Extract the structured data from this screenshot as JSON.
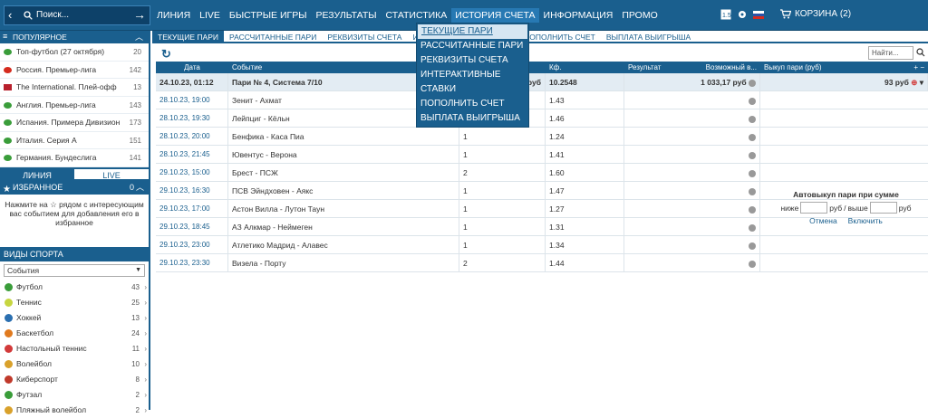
{
  "search": {
    "placeholder": "Поиск..."
  },
  "nav": [
    "ЛИНИЯ",
    "LIVE",
    "БЫСТРЫЕ ИГРЫ",
    "РЕЗУЛЬТАТЫ",
    "СТАТИСТИКА",
    "ИСТОРИЯ СЧЕТА",
    "ИНФОРМАЦИЯ",
    "ПРОМО"
  ],
  "cart": {
    "label": "КОРЗИНА (2)"
  },
  "popular": {
    "title": "ПОПУЛЯРНОЕ",
    "items": [
      {
        "label": "Топ-футбол (27 октября)",
        "count": "20"
      },
      {
        "label": "Россия. Премьер-лига",
        "count": "142"
      },
      {
        "label": "The International. Плей-офф",
        "count": "13"
      },
      {
        "label": "Англия. Премьер-лига",
        "count": "143"
      },
      {
        "label": "Испания. Примера Дивизион",
        "count": "173"
      },
      {
        "label": "Италия. Серия А",
        "count": "151"
      },
      {
        "label": "Германия. Бундеслига",
        "count": "141"
      }
    ]
  },
  "sidetabs": {
    "line": "ЛИНИЯ",
    "live": "LIVE"
  },
  "favorites": {
    "title": "ИЗБРАННОЕ",
    "count": "0",
    "text": "Нажмите на ☆ рядом с интересующим вас событием для добавления его в избранное"
  },
  "sports": {
    "title": "ВИДЫ СПОРТА",
    "select": "События",
    "items": [
      {
        "label": "Футбол",
        "count": "43",
        "color": "#3a9d3a"
      },
      {
        "label": "Теннис",
        "count": "25",
        "color": "#c7d640"
      },
      {
        "label": "Хоккей",
        "count": "13",
        "color": "#2b6fb0"
      },
      {
        "label": "Баскетбол",
        "count": "24",
        "color": "#e07a1e"
      },
      {
        "label": "Настольный теннис",
        "count": "11",
        "color": "#d23a3a"
      },
      {
        "label": "Волейбол",
        "count": "10",
        "color": "#d9a12b"
      },
      {
        "label": "Киберспорт",
        "count": "8",
        "color": "#c0392b"
      },
      {
        "label": "Футзал",
        "count": "2",
        "color": "#3a9d3a"
      },
      {
        "label": "Пляжный волейбол",
        "count": "2",
        "color": "#d9a12b"
      }
    ]
  },
  "subtabs": [
    "ТЕКУЩИЕ ПАРИ",
    "РАССЧИТАННЫЕ ПАРИ",
    "РЕКВИЗИТЫ СЧЕТА",
    "ИНТЕРАКТИВНЫЕ СТАВКИ",
    "ПОПОЛНИТЬ СЧЕТ",
    "ВЫПЛАТА ВЫИГРЫША"
  ],
  "table_search": "Найти...",
  "headers": {
    "date": "Дата",
    "event": "Событие",
    "outcome": "Исход",
    "kf": "Кф.",
    "result": "Результат",
    "possible": "Возможный в...",
    "buyout": "Выкуп пари (руб)"
  },
  "summary": {
    "date": "24.10.23, 01:12",
    "event": "Пари № 4, Система 7/10",
    "stake": "100 руб",
    "kf": "10.2548",
    "possible": "1 033,17 руб",
    "buyout": "93 руб"
  },
  "rows": [
    {
      "date": "28.10.23, 19:00",
      "event": "Зенит - Ахмат",
      "out": "1",
      "kf": "1.43"
    },
    {
      "date": "28.10.23, 19:30",
      "event": "Лейпциг - Кёльн",
      "out": "1",
      "kf": "1.46"
    },
    {
      "date": "28.10.23, 20:00",
      "event": "Бенфика - Каса Пиа",
      "out": "1",
      "kf": "1.24"
    },
    {
      "date": "28.10.23, 21:45",
      "event": "Ювентус - Верона",
      "out": "1",
      "kf": "1.41"
    },
    {
      "date": "29.10.23, 15:00",
      "event": "Брест - ПСЖ",
      "out": "2",
      "kf": "1.60"
    },
    {
      "date": "29.10.23, 16:30",
      "event": "ПСВ Эйндховен - Аякс",
      "out": "1",
      "kf": "1.47"
    },
    {
      "date": "29.10.23, 17:00",
      "event": "Астон Вилла - Лутон Таун",
      "out": "1",
      "kf": "1.27"
    },
    {
      "date": "29.10.23, 18:45",
      "event": "АЗ Алкмар - Неймеген",
      "out": "1",
      "kf": "1.31"
    },
    {
      "date": "29.10.23, 23:00",
      "event": "Атлетико Мадрид - Алавес",
      "out": "1",
      "kf": "1.34"
    },
    {
      "date": "29.10.23, 23:30",
      "event": "Визела - Порту",
      "out": "2",
      "kf": "1.44"
    }
  ],
  "autobuy": {
    "title": "Автовыкуп пари при сумме",
    "below": "ниже",
    "rub": "руб",
    "sep": "/",
    "above": "выше",
    "cancel": "Отмена",
    "enable": "Включить"
  },
  "dropdown": [
    "ТЕКУЩИЕ ПАРИ",
    "РАССЧИТАННЫЕ ПАРИ",
    "РЕКВИЗИТЫ СЧЕТА",
    "ИНТЕРАКТИВНЫЕ СТАВКИ",
    "ПОПОЛНИТЬ СЧЕТ",
    "ВЫПЛАТА ВЫИГРЫША"
  ]
}
